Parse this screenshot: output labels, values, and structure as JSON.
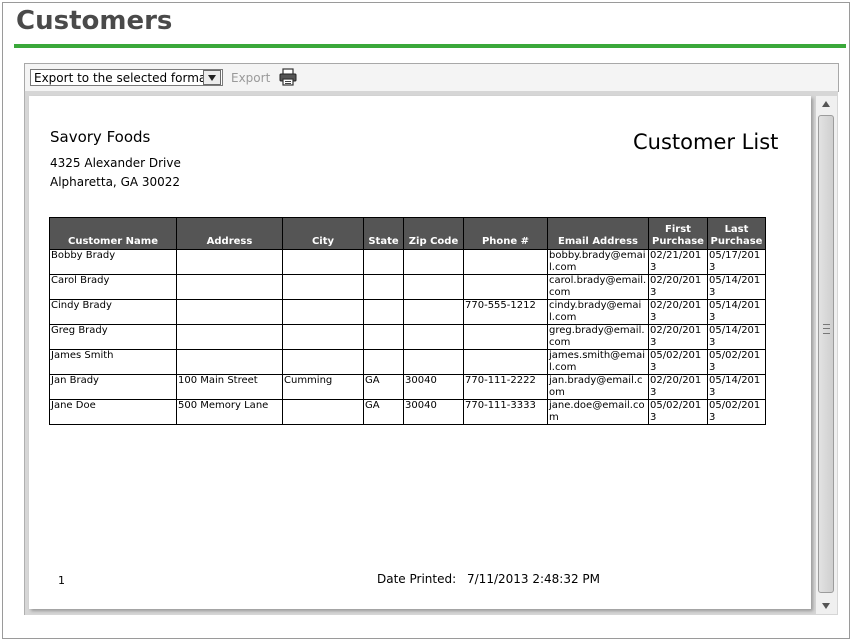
{
  "page": {
    "title": "Customers"
  },
  "toolbar": {
    "export_format": "Export to the selected format",
    "export_label": "Export",
    "print_icon": "printer-icon"
  },
  "report": {
    "company": "Savory Foods",
    "address_line1": "4325 Alexander Drive",
    "address_line2": "Alpharetta, GA 30022",
    "title": "Customer List",
    "columns": [
      "Customer Name",
      "Address",
      "City",
      "State",
      "Zip Code",
      "Phone #",
      "Email Address",
      "First Purchase",
      "Last Purchase"
    ],
    "rows": [
      [
        "Bobby Brady",
        "",
        "",
        "",
        "",
        "",
        "bobby.brady@email.com",
        "02/21/2013",
        "05/17/2013"
      ],
      [
        "Carol Brady",
        "",
        "",
        "",
        "",
        "",
        "carol.brady@email.com",
        "02/20/2013",
        "05/14/2013"
      ],
      [
        "Cindy Brady",
        "",
        "",
        "",
        "",
        "770-555-1212",
        "cindy.brady@email.com",
        "02/20/2013",
        "05/14/2013"
      ],
      [
        "Greg Brady",
        "",
        "",
        "",
        "",
        "",
        "greg.brady@email.com",
        "02/20/2013",
        "05/14/2013"
      ],
      [
        "James Smith",
        "",
        "",
        "",
        "",
        "",
        "james.smith@email.com",
        "05/02/2013",
        "05/02/2013"
      ],
      [
        "Jan Brady",
        "100 Main Street",
        "Cumming",
        "GA",
        "30040",
        "770-111-2222",
        "jan.brady@email.com",
        "02/20/2013",
        "05/14/2013"
      ],
      [
        "Jane Doe",
        "500 Memory Lane",
        "",
        "GA",
        "30040",
        "770-111-3333",
        "jane.doe@email.com",
        "05/02/2013",
        "05/02/2013"
      ]
    ],
    "page_number": "1",
    "date_printed_label": "Date Printed:",
    "date_printed_value": "7/11/2013 2:48:32 PM"
  }
}
